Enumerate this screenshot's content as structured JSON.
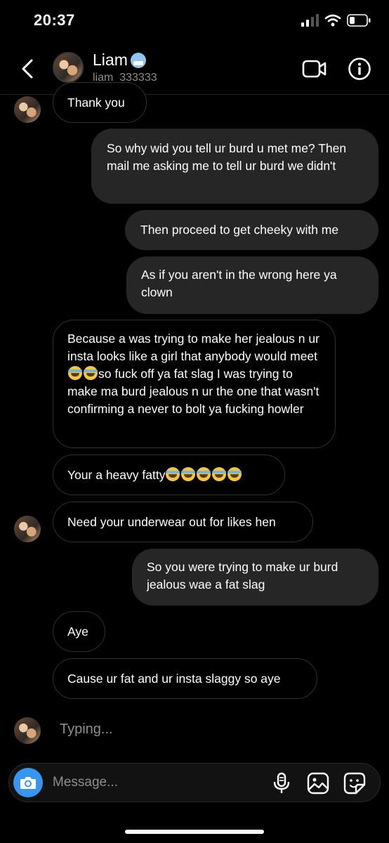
{
  "status": {
    "time": "20:37"
  },
  "header": {
    "name": "Liam",
    "username": "liam_333333"
  },
  "messages": [
    {
      "text": "Thank you"
    },
    {
      "text": "So why wid you tell ur burd u met me? Then mail me asking me to tell ur burd we didn't"
    },
    {
      "text": "Then proceed to get cheeky with me"
    },
    {
      "text": "As if you aren't in the wrong here ya clown"
    },
    {
      "text_a": "Because a was trying to make her jealous n ur insta looks like a girl that anybody would meet",
      "text_b": "so fuck off ya fat slag I was trying to make ma burd jealous n ur the one that wasn't confirming a never to bolt ya fucking howler"
    },
    {
      "text": "Your a heavy fatty"
    },
    {
      "text": "Need your underwear out for likes hen"
    },
    {
      "text": "So you were trying to make ur burd jealous wae a fat slag"
    },
    {
      "text": "Aye"
    },
    {
      "text": "Cause ur fat and ur insta slaggy so aye"
    }
  ],
  "typing": "Typing...",
  "composer": {
    "placeholder": "Message..."
  },
  "icons": {
    "back": "chevron-left-icon",
    "video": "video-camera-icon",
    "info": "info-icon",
    "camera": "camera-icon",
    "mic": "microphone-icon",
    "gallery": "image-icon",
    "sticker": "sticker-icon"
  },
  "colors": {
    "accent": "#3797f0",
    "bubble_out": "#262626",
    "muted": "#8e8e8e"
  }
}
